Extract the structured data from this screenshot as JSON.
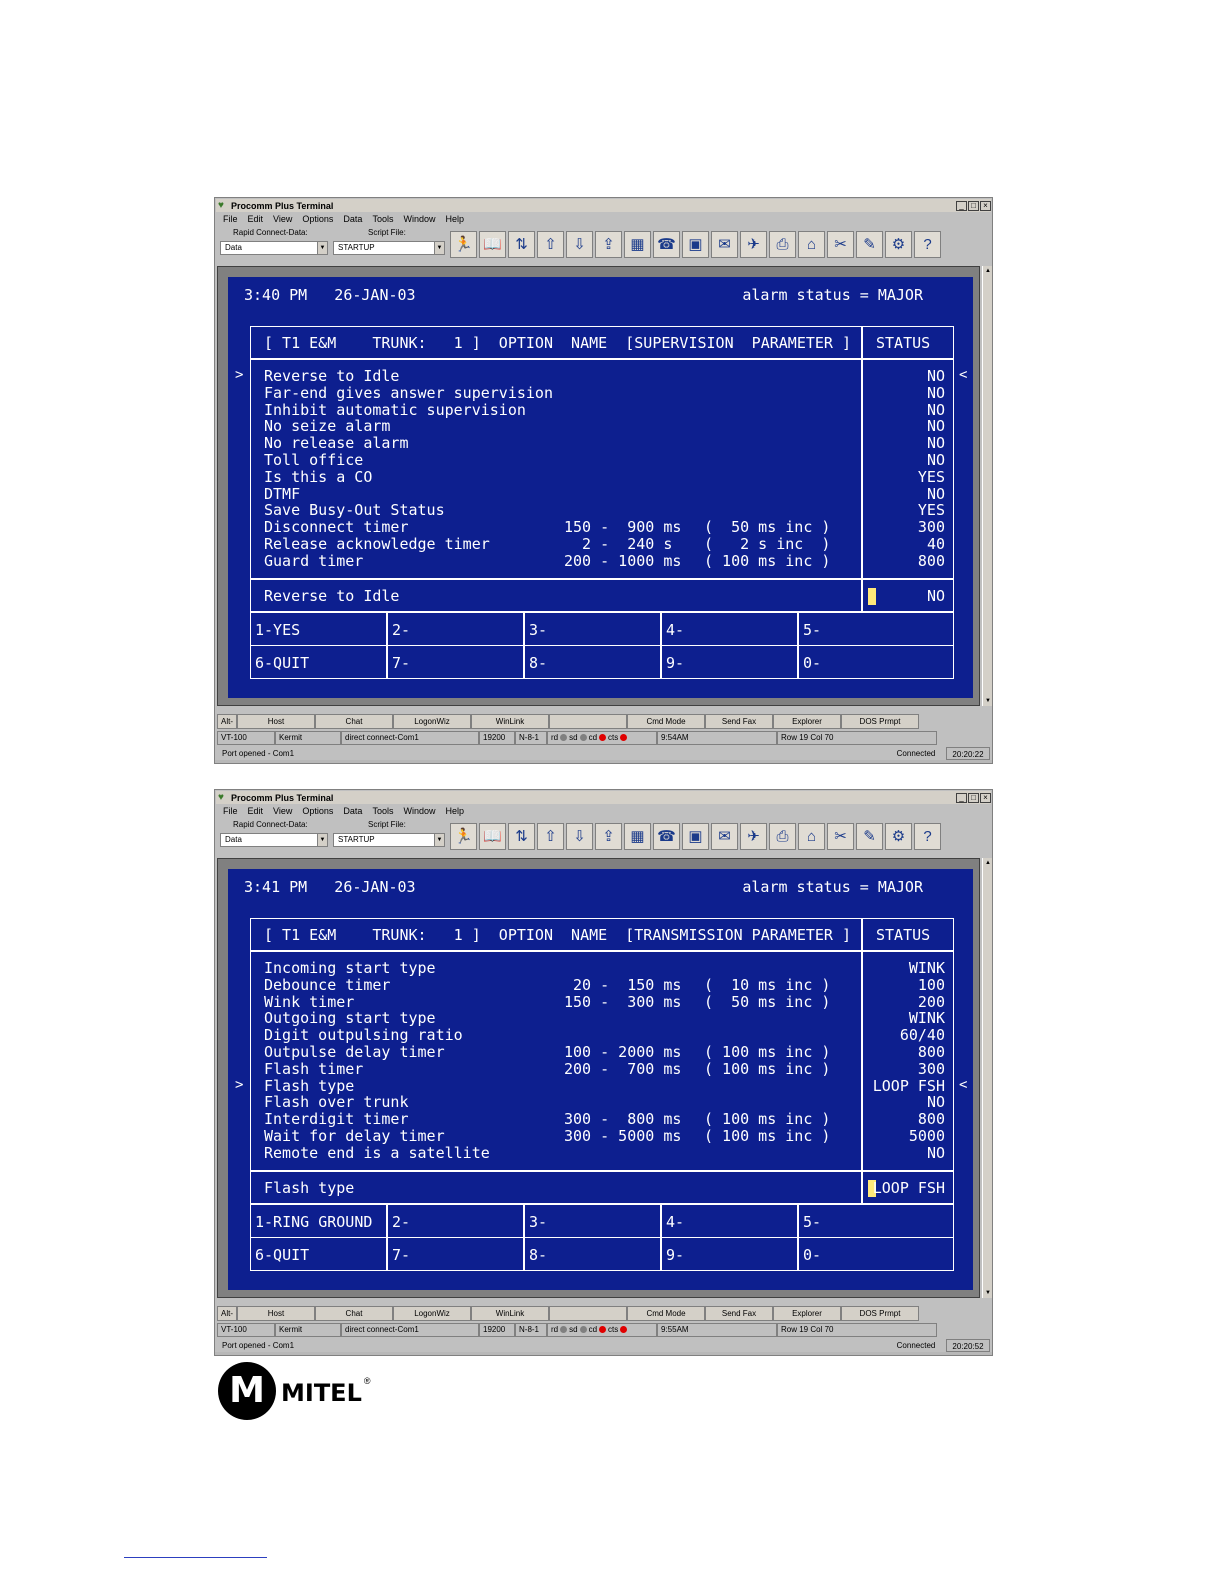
{
  "window_common": {
    "title": "Procomm Plus Terminal",
    "controls": [
      "_",
      "□",
      "×"
    ],
    "menu": [
      "File",
      "Edit",
      "View",
      "Options",
      "Data",
      "Tools",
      "Window",
      "Help"
    ],
    "rapid_connect_label": "Rapid Connect-Data:",
    "rapid_connect_value": "Data",
    "script_file_label": "Script File:",
    "script_file_value": "STARTUP",
    "toolbar_icons": [
      "run-script-icon",
      "phonebook-icon",
      "mode-icon",
      "send-file-icon",
      "receive-file-icon",
      "upload-icon",
      "capture-icon",
      "dial-icon",
      "monitor-icon",
      "chat-icon",
      "fax-icon",
      "print-icon",
      "network-icon",
      "tools-icon",
      "cut-icon",
      "settings-icon",
      "help-globe-icon"
    ],
    "button_bar": [
      "Alt-",
      "Host",
      "Chat",
      "LogonWiz",
      "WinLink",
      "",
      "Cmd Mode",
      "Send Fax",
      "Explorer",
      "DOS Prmpt"
    ],
    "status_terminal": "VT-100",
    "status_protocol": "Kermit",
    "status_connection": "direct connect-Com1",
    "status_baud": "19200",
    "status_params": "N-8-1",
    "status_leds": [
      {
        "label": "rd",
        "color": "#808080"
      },
      {
        "label": "sd",
        "color": "#808080"
      },
      {
        "label": "cd",
        "color": "#e00000"
      },
      {
        "label": "cts",
        "color": "#e00000"
      }
    ],
    "status_position": "Row 19   Col 70",
    "bottom_message": "Port opened - Com1",
    "bottom_connected": "Connected"
  },
  "screen1": {
    "clock": "3:40 PM   26-JAN-03",
    "alarm": "alarm status = MAJOR",
    "header": "[ T1 E&M    TRUNK:   1 ]  OPTION  NAME  [SUPERVISION  PARAMETER ]",
    "status_header": "STATUS",
    "rows": [
      {
        "name": "Reverse to Idle",
        "range": "",
        "inc": "",
        "value": "NO"
      },
      {
        "name": "Far-end gives answer supervision",
        "range": "",
        "inc": "",
        "value": "NO"
      },
      {
        "name": "Inhibit automatic supervision",
        "range": "",
        "inc": "",
        "value": "NO"
      },
      {
        "name": "No seize alarm",
        "range": "",
        "inc": "",
        "value": "NO"
      },
      {
        "name": "No release alarm",
        "range": "",
        "inc": "",
        "value": "NO"
      },
      {
        "name": "Toll office",
        "range": "",
        "inc": "",
        "value": "NO"
      },
      {
        "name": "Is this a CO",
        "range": "",
        "inc": "",
        "value": "YES"
      },
      {
        "name": "DTMF",
        "range": "",
        "inc": "",
        "value": "NO"
      },
      {
        "name": "Save Busy-Out Status",
        "range": "",
        "inc": "",
        "value": "YES"
      },
      {
        "name": "Disconnect timer",
        "range": "150 -  900 ms",
        "inc": "(  50 ms inc )",
        "value": "300"
      },
      {
        "name": "Release acknowledge timer",
        "range": "  2 -  240 s ",
        "inc": "(   2 s inc  )",
        "value": "40"
      },
      {
        "name": "Guard timer",
        "range": "200 - 1000 ms",
        "inc": "( 100 ms inc )",
        "value": "800"
      }
    ],
    "selector_left": ">",
    "selector_right": "<",
    "prompt": "Reverse to Idle",
    "prompt_value": "NO",
    "options": [
      "1-YES",
      "2-",
      "3-",
      "4-",
      "5-",
      "6-QUIT",
      "7-",
      "8-",
      "9-",
      "0-"
    ],
    "status_time": "9:54AM",
    "clock_time": "20:20:22"
  },
  "screen2": {
    "clock": "3:41 PM   26-JAN-03",
    "alarm": "alarm status = MAJOR",
    "header": "[ T1 E&M    TRUNK:   1 ]  OPTION  NAME  [TRANSMISSION PARAMETER ]",
    "status_header": "STATUS",
    "rows": [
      {
        "name": "Incoming start type",
        "range": "",
        "inc": "",
        "value": "WINK"
      },
      {
        "name": "Debounce timer",
        "range": " 20 -  150 ms",
        "inc": "(  10 ms inc )",
        "value": "100"
      },
      {
        "name": "Wink timer",
        "range": "150 -  300 ms",
        "inc": "(  50 ms inc )",
        "value": "200"
      },
      {
        "name": "Outgoing start type",
        "range": "",
        "inc": "",
        "value": "WINK"
      },
      {
        "name": "Digit outpulsing ratio",
        "range": "",
        "inc": "",
        "value": "60/40"
      },
      {
        "name": "Outpulse delay timer",
        "range": "100 - 2000 ms",
        "inc": "( 100 ms inc )",
        "value": "800"
      },
      {
        "name": "Flash timer",
        "range": "200 -  700 ms",
        "inc": "( 100 ms inc )",
        "value": "300"
      },
      {
        "name": "Flash type",
        "range": "",
        "inc": "",
        "value": "LOOP FSH"
      },
      {
        "name": "Flash over trunk",
        "range": "",
        "inc": "",
        "value": "NO"
      },
      {
        "name": "Interdigit timer",
        "range": "300 -  800 ms",
        "inc": "( 100 ms inc )",
        "value": "800"
      },
      {
        "name": "Wait for delay timer",
        "range": "300 - 5000 ms",
        "inc": "( 100 ms inc )",
        "value": "5000"
      },
      {
        "name": "Remote end is a satellite",
        "range": "",
        "inc": "",
        "value": "NO"
      }
    ],
    "selector_left": ">",
    "selector_right": "<",
    "prompt": "Flash type",
    "prompt_value": "LOOP FSH",
    "options": [
      "1-RING GROUND",
      "2-",
      "3-",
      "4-",
      "5-",
      "6-QUIT",
      "7-",
      "8-",
      "9-",
      "0-"
    ],
    "status_time": "9:55AM",
    "clock_time": "20:20:52"
  },
  "logo": {
    "text": "MITEL",
    "registered": "®"
  }
}
